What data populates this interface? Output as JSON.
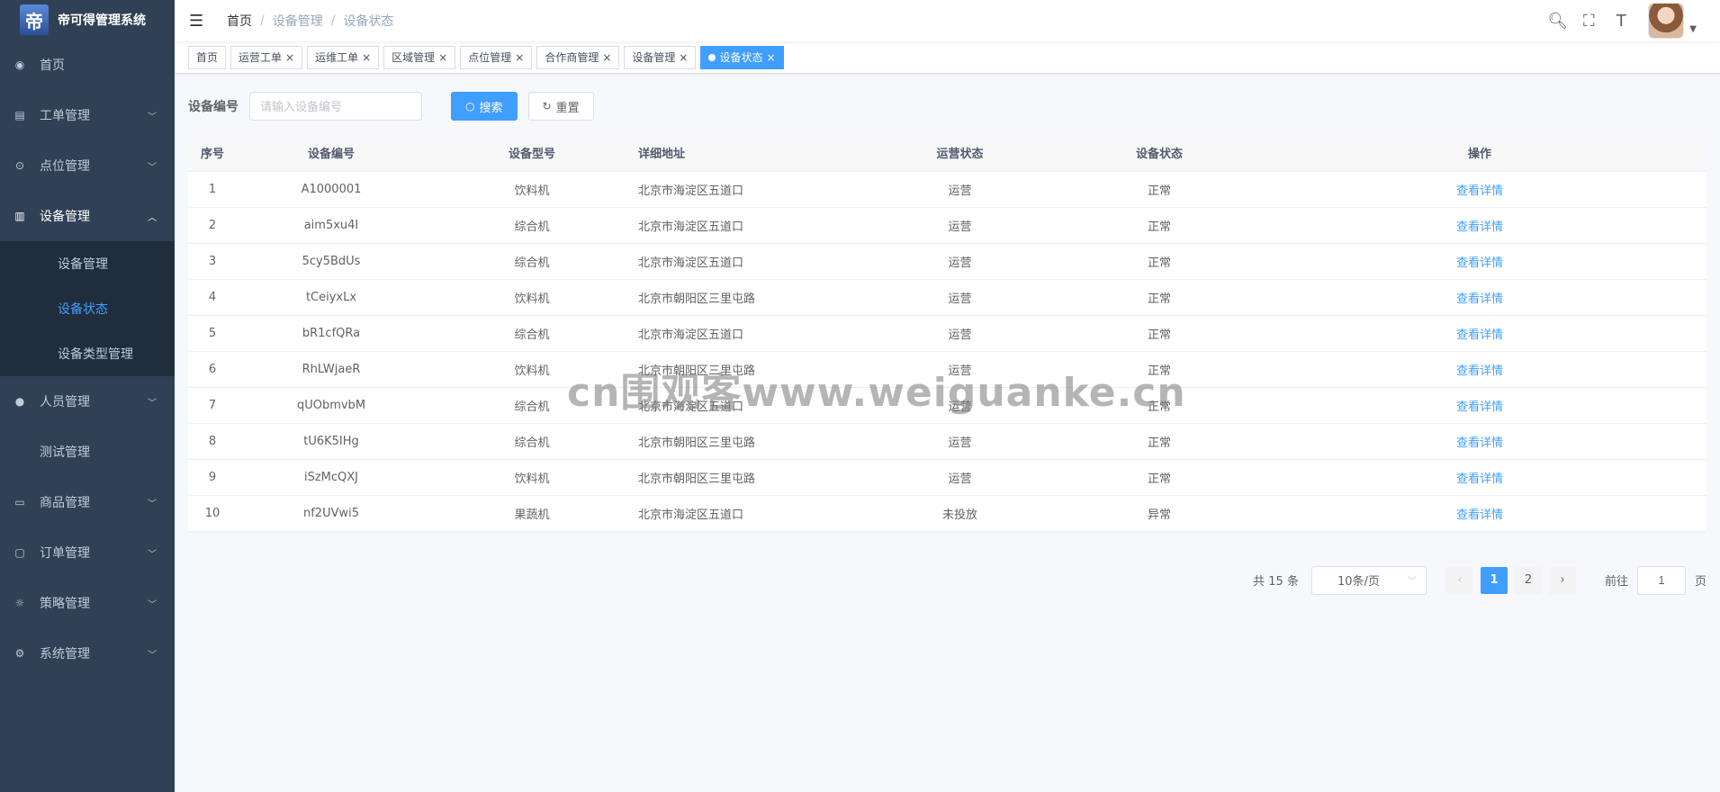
{
  "app": {
    "logo_char": "帝",
    "title": "帝可得管理系统"
  },
  "sidebar": {
    "items": [
      {
        "label": "首页",
        "icon": "dashboard-icon"
      },
      {
        "label": "工单管理",
        "icon": "clipboard-icon"
      },
      {
        "label": "点位管理",
        "icon": "location-icon"
      },
      {
        "label": "设备管理",
        "icon": "device-icon"
      },
      {
        "label": "人员管理",
        "icon": "people-icon"
      },
      {
        "label": "测试管理"
      },
      {
        "label": "商品管理",
        "icon": "goods-icon"
      },
      {
        "label": "订单管理",
        "icon": "order-icon"
      },
      {
        "label": "策略管理",
        "icon": "bulb-icon"
      },
      {
        "label": "系统管理",
        "icon": "gear-icon"
      }
    ],
    "device_sub": [
      "设备管理",
      "设备状态",
      "设备类型管理"
    ]
  },
  "breadcrumb": [
    "首页",
    "设备管理",
    "设备状态"
  ],
  "tags": [
    "首页",
    "运营工单",
    "运维工单",
    "区域管理",
    "点位管理",
    "合作商管理",
    "设备管理",
    "设备状态"
  ],
  "search": {
    "label": "设备编号",
    "placeholder": "请输入设备编号",
    "search_btn": "搜索",
    "reset_btn": "重置"
  },
  "table": {
    "headers": [
      "序号",
      "设备编号",
      "设备型号",
      "详细地址",
      "运营状态",
      "设备状态",
      "操作"
    ],
    "rows": [
      [
        "1",
        "A1000001",
        "饮料机",
        "北京市海淀区五道口",
        "运营",
        "正常",
        "查看详情"
      ],
      [
        "2",
        "aim5xu4I",
        "综合机",
        "北京市海淀区五道口",
        "运营",
        "正常",
        "查看详情"
      ],
      [
        "3",
        "5cy5BdUs",
        "综合机",
        "北京市海淀区五道口",
        "运营",
        "正常",
        "查看详情"
      ],
      [
        "4",
        "tCeiyxLx",
        "饮料机",
        "北京市朝阳区三里屯路",
        "运营",
        "正常",
        "查看详情"
      ],
      [
        "5",
        "bR1cfQRa",
        "综合机",
        "北京市海淀区五道口",
        "运营",
        "正常",
        "查看详情"
      ],
      [
        "6",
        "RhLWjaeR",
        "饮料机",
        "北京市朝阳区三里屯路",
        "运营",
        "正常",
        "查看详情"
      ],
      [
        "7",
        "qUObmvbM",
        "综合机",
        "北京市海淀区五道口",
        "运营",
        "正常",
        "查看详情"
      ],
      [
        "8",
        "tU6K5IHg",
        "综合机",
        "北京市朝阳区三里屯路",
        "运营",
        "正常",
        "查看详情"
      ],
      [
        "9",
        "iSzMcQXJ",
        "饮料机",
        "北京市朝阳区三里屯路",
        "运营",
        "正常",
        "查看详情"
      ],
      [
        "10",
        "nf2UVwi5",
        "果蔬机",
        "北京市海淀区五道口",
        "未投放",
        "异常",
        "查看详情"
      ]
    ]
  },
  "pagination": {
    "total": "共 15 条",
    "page_size": "10条/页",
    "pages": [
      "1",
      "2"
    ],
    "current": "1",
    "goto_prefix": "前往",
    "goto_value": "1",
    "goto_suffix": "页"
  },
  "watermark": "cn围观客www.weiguanke.cn",
  "colors": {
    "primary": "#409eff",
    "sidebar_bg": "#304156",
    "submenu_bg": "#1f2d3d"
  }
}
